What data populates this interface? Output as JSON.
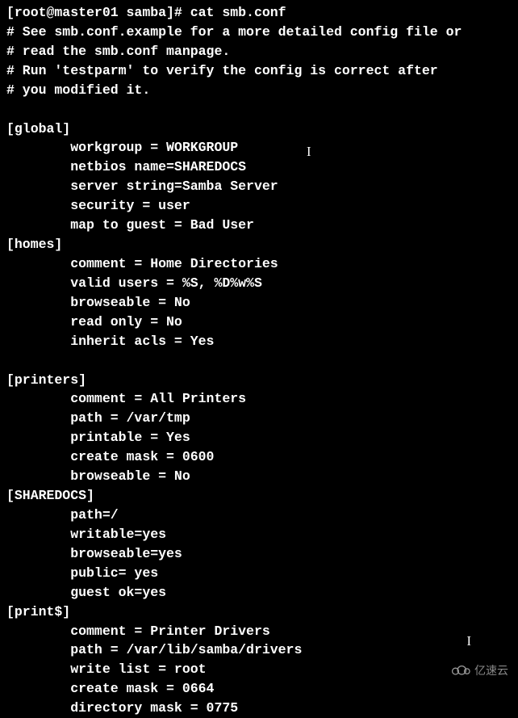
{
  "terminal": {
    "prompt_line": "[root@master01 samba]# cat smb.conf",
    "lines": [
      "# See smb.conf.example for a more detailed config file or",
      "# read the smb.conf manpage.",
      "# Run 'testparm' to verify the config is correct after",
      "# you modified it.",
      "",
      "[global]",
      "        workgroup = WORKGROUP",
      "        netbios name=SHAREDOCS",
      "        server string=Samba Server",
      "        security = user",
      "        map to guest = Bad User",
      "[homes]",
      "        comment = Home Directories",
      "        valid users = %S, %D%w%S",
      "        browseable = No",
      "        read only = No",
      "        inherit acls = Yes",
      "",
      "[printers]",
      "        comment = All Printers",
      "        path = /var/tmp",
      "        printable = Yes",
      "        create mask = 0600",
      "        browseable = No",
      "[SHAREDOCS]",
      "        path=/",
      "        writable=yes",
      "        browseable=yes",
      "        public= yes",
      "        guest ok=yes",
      "[print$]",
      "        comment = Printer Drivers",
      "        path = /var/lib/samba/drivers",
      "        write list = root",
      "        create mask = 0664",
      "        directory mask = 0775"
    ]
  },
  "watermark": {
    "text": "亿速云"
  },
  "cursors": {
    "c1": "I",
    "c2": "I"
  }
}
